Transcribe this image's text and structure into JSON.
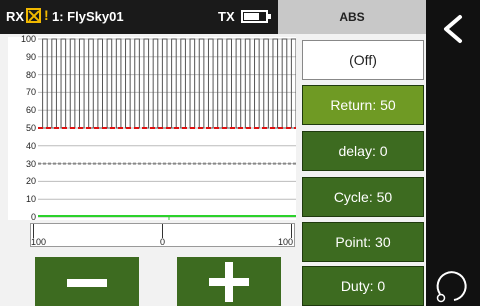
{
  "status": {
    "rx_label": "RX",
    "warning_glyph": "!",
    "model_label": "1: FlySky01",
    "tx_label": "TX",
    "battery_level": 0.65
  },
  "header": {
    "title": "ABS"
  },
  "graph": {
    "y_ticks": [
      "100",
      "90",
      "80",
      "70",
      "60",
      "50",
      "40",
      "30",
      "20",
      "10",
      "0"
    ],
    "red_level": 50,
    "dashed_level": 30,
    "green_level": 0,
    "pulse_count": 28,
    "colors": {
      "red": "#e01010",
      "green": "#2bd22b",
      "dashed": "#888888",
      "grid": "#bbbbbb",
      "bars": "#555555"
    }
  },
  "scale": {
    "left_label": "100",
    "center_label": "0",
    "right_label": "100"
  },
  "controls": {
    "minus_icon": "minus-icon",
    "plus_icon": "plus-icon"
  },
  "options": [
    {
      "label": "(Off)",
      "state": "off"
    },
    {
      "label": "Return: 50",
      "state": "active"
    },
    {
      "label": "delay: 0",
      "state": "normal"
    },
    {
      "label": "Cycle: 50",
      "state": "normal"
    },
    {
      "label": "Point: 30",
      "state": "normal"
    },
    {
      "label": "Duty: 0",
      "state": "normal"
    }
  ],
  "rail": {
    "back_icon": "chevron-left-icon",
    "rotate_icon": "rotate-icon"
  }
}
